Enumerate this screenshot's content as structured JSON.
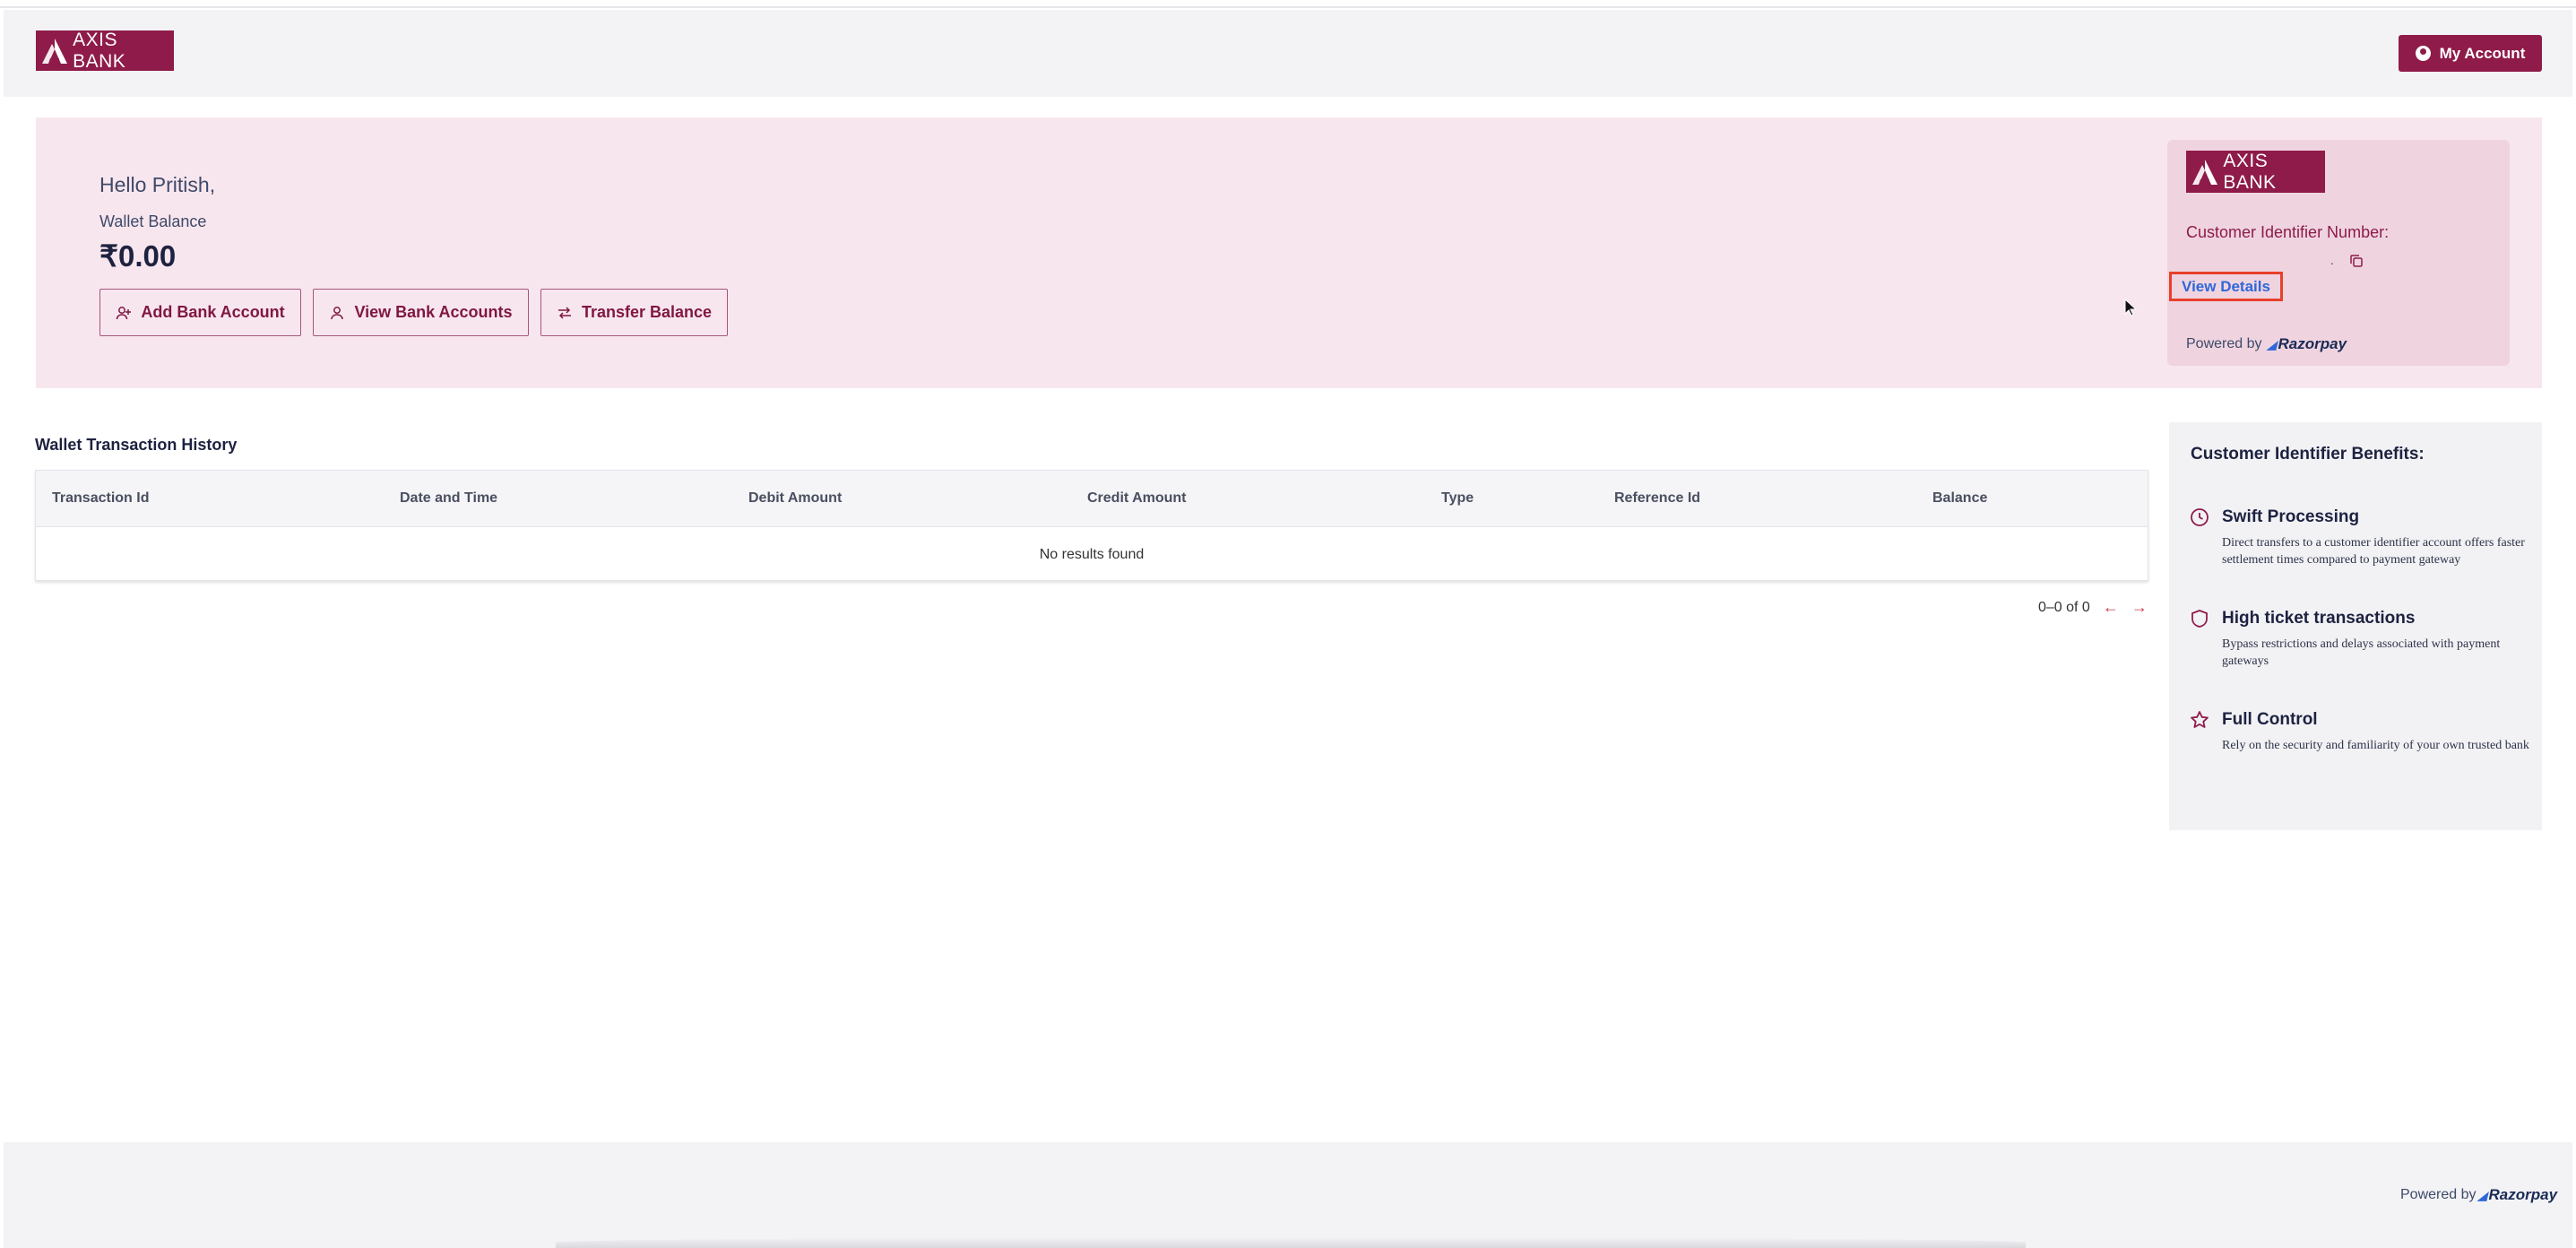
{
  "header": {
    "logo_text": "AXIS BANK",
    "my_account_label": "My Account"
  },
  "hero": {
    "greeting": "Hello Pritish,",
    "wallet_balance_label": "Wallet Balance",
    "wallet_balance_value": "₹0.00",
    "buttons": {
      "add_bank_account": "Add Bank Account",
      "view_bank_accounts": "View Bank Accounts",
      "transfer_balance": "Transfer Balance"
    }
  },
  "ci_card": {
    "logo_text": "AXIS BANK",
    "label": "Customer Identifier Number:",
    "value": ".",
    "view_details_label": "View Details",
    "powered_by": "Powered by",
    "razorpay": "Razorpay"
  },
  "transactions": {
    "title": "Wallet Transaction History",
    "columns": [
      "Transaction Id",
      "Date and Time",
      "Debit Amount",
      "Credit Amount",
      "Type",
      "Reference Id",
      "Balance"
    ],
    "empty_text": "No results found",
    "pagination": "0–0 of 0",
    "prev_arrow": "←",
    "next_arrow": "→"
  },
  "benefits": {
    "title": "Customer Identifier Benefits:",
    "items": [
      {
        "title": "Swift Processing",
        "desc": "Direct transfers to a customer identifier account offers faster settlement times compared to payment gateway",
        "icon": "clock-icon"
      },
      {
        "title": "High ticket transactions",
        "desc": "Bypass restrictions and delays associated with payment gateways",
        "icon": "shield-icon"
      },
      {
        "title": "Full Control",
        "desc": "Rely on the security and familiarity of your own trusted bank",
        "icon": "star-icon"
      }
    ]
  },
  "footer": {
    "powered_by": "Powered by",
    "razorpay": "Razorpay"
  },
  "colors": {
    "brand": "#8e1b49",
    "hero_bg": "#f8e6ef",
    "link": "#2f67d9",
    "highlight": "#e8402a"
  }
}
